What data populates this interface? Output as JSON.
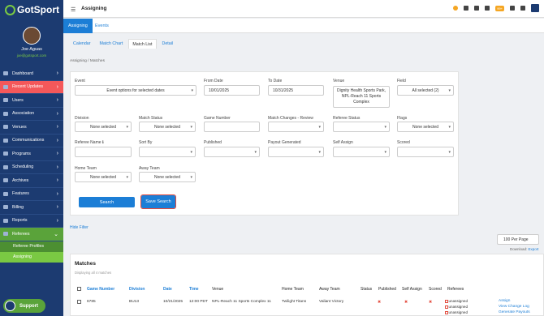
{
  "app": {
    "logo": "GotSport",
    "page_title": "Assigning",
    "notif_badge": "99+"
  },
  "profile": {
    "name": "Joe Aguas",
    "email": "joe@gotsport.com"
  },
  "sidebar": {
    "items": [
      {
        "label": "Dashboard",
        "chev": "›"
      },
      {
        "label": "Recent Updates",
        "chev": "›"
      },
      {
        "label": "Users",
        "chev": "›"
      },
      {
        "label": "Association",
        "chev": "›"
      },
      {
        "label": "Venues",
        "chev": "›"
      },
      {
        "label": "Communications",
        "chev": "›"
      },
      {
        "label": "Programs",
        "chev": "›"
      },
      {
        "label": "Scheduling",
        "chev": "›"
      },
      {
        "label": "Archives",
        "chev": "›"
      },
      {
        "label": "Features",
        "chev": "›"
      },
      {
        "label": "Billing",
        "chev": "›"
      },
      {
        "label": "Reports",
        "chev": "›"
      },
      {
        "label": "Referees",
        "chev": "⌄"
      }
    ],
    "sub_items": [
      {
        "label": "Referee Profiles"
      },
      {
        "label": "Assigning"
      }
    ],
    "support": "Support"
  },
  "tabs": {
    "primary": [
      {
        "label": "Assigning"
      },
      {
        "label": "Events"
      }
    ],
    "secondary": [
      {
        "label": "Calendar"
      },
      {
        "label": "Match Chart"
      },
      {
        "label": "Match List"
      },
      {
        "label": "Detail"
      }
    ]
  },
  "breadcrumb": {
    "home": "Assigning",
    "sep": "/",
    "current": "Matches"
  },
  "filters": {
    "event": {
      "label": "Event",
      "value": "Event options for selected dates"
    },
    "from_date": {
      "label": "From Date",
      "value": "10/01/2025"
    },
    "to_date": {
      "label": "To Date",
      "value": "10/31/2025"
    },
    "venue": {
      "label": "Venue",
      "value": "Dignity Health Sports Park, NPL-Reach 11 Sports Complex"
    },
    "field": {
      "label": "Field",
      "value": "All selected (2)"
    },
    "division": {
      "label": "Division",
      "value": "None selected"
    },
    "match_status": {
      "label": "Match Status",
      "value": "None selected"
    },
    "game_number": {
      "label": "Game Number",
      "value": ""
    },
    "match_changes": {
      "label": "Match Changes - Review",
      "value": ""
    },
    "referee_status": {
      "label": "Referee Status",
      "value": ""
    },
    "flags": {
      "label": "Flags",
      "value": "None selected"
    },
    "referee_name": {
      "label": "Referee Name ℹ",
      "value": ""
    },
    "sort_by": {
      "label": "Sort By",
      "value": ""
    },
    "published": {
      "label": "Published",
      "value": ""
    },
    "payout_generated": {
      "label": "Payout Generated",
      "value": ""
    },
    "self_assign": {
      "label": "Self Assign",
      "value": ""
    },
    "scored": {
      "label": "Scored",
      "value": ""
    },
    "home_team": {
      "label": "Home Team",
      "value": "None selected"
    },
    "away_team": {
      "label": "Away Team",
      "value": "None selected"
    },
    "search_button": "Search",
    "save_search_button": "Save Search"
  },
  "hide_filter": "Hide Filter",
  "per_page": "100 Per Page",
  "download": {
    "label": "Download:",
    "link": "Export"
  },
  "matches": {
    "title": "Matches",
    "subtitle": "Displaying all 4 matches",
    "headers": {
      "game_number": "Game Number",
      "division": "Division",
      "date": "Date",
      "time": "Time",
      "venue": "Venue",
      "home_team": "Home Team",
      "away_team": "Away Team",
      "status": "Status",
      "published": "Published",
      "self_assign": "Self Assign",
      "scored": "Scored",
      "referees": "Referees"
    },
    "row": {
      "game_number": "6785",
      "division": "BU13",
      "date": "10/21/2025",
      "time": "12:00 PDT",
      "venue": "NPL-Reach 11 Sports Complex 11",
      "home_team": "Twilight Titans",
      "away_team": "Valiant Victory",
      "referees": [
        "unassigned",
        "unassigned",
        "unassigned"
      ],
      "actions": [
        "Assign",
        "View Change Log",
        "Generate Payouts"
      ]
    }
  },
  "colors": {
    "sidebar": "#1c3b71",
    "accent": "#1c7ed6",
    "green": "#7ac943",
    "alert": "#f4585a"
  }
}
